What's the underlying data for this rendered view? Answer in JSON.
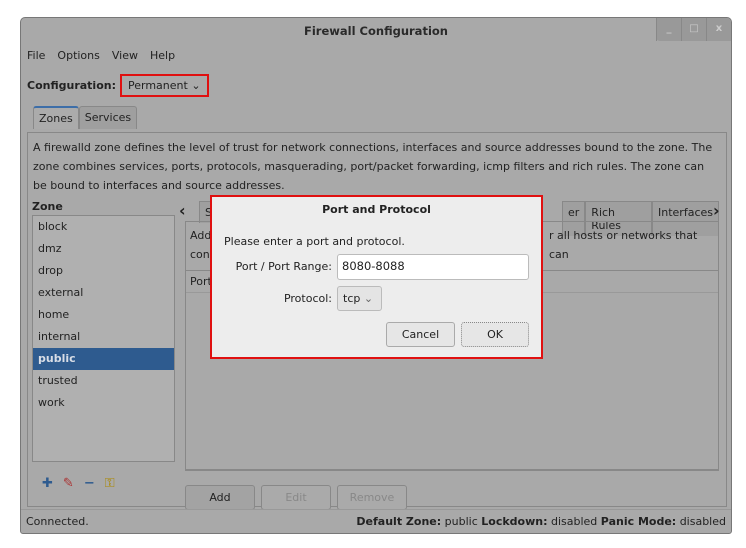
{
  "window": {
    "title": "Firewall Configuration",
    "controls": [
      "_",
      "□",
      "x"
    ]
  },
  "menu": [
    "File",
    "Options",
    "View",
    "Help"
  ],
  "configuration": {
    "label": "Configuration:",
    "value": "Permanent"
  },
  "tabs": [
    "Zones",
    "Services"
  ],
  "description": "A firewalld zone defines the level of trust for network connections, interfaces and source addresses bound to the zone. The zone combines services, ports, protocols, masquerading, port/packet forwarding, icmp filters and rich rules. The zone can be bound to interfaces and source addresses.",
  "zone": {
    "label": "Zone",
    "items": [
      "block",
      "dmz",
      "drop",
      "external",
      "home",
      "internal",
      "public",
      "trusted",
      "work"
    ],
    "selected": "public"
  },
  "zone_tabs": {
    "visible_partial": [
      "S",
      "er"
    ],
    "items": [
      "Rich Rules",
      "Interfaces"
    ]
  },
  "ports_panel": {
    "desc_left": "Add a",
    "desc_left2": "conn",
    "desc_right": "r all hosts or networks that can",
    "column": "Port",
    "buttons": [
      "Add",
      "Edit",
      "Remove"
    ]
  },
  "status": {
    "left": "Connected.",
    "default_zone_label": "Default Zone:",
    "default_zone": "public",
    "lockdown_label": "Lockdown:",
    "lockdown": "disabled",
    "panic_label": "Panic Mode:",
    "panic": "disabled"
  },
  "dialog": {
    "title": "Port and Protocol",
    "message": "Please enter a port and protocol.",
    "port_label": "Port / Port Range:",
    "port_value": "8080-8088",
    "protocol_label": "Protocol:",
    "protocol_value": "tcp",
    "cancel": "Cancel",
    "ok": "OK"
  },
  "colors": {
    "highlight": "#e01010",
    "selection": "#2e5b8f"
  }
}
